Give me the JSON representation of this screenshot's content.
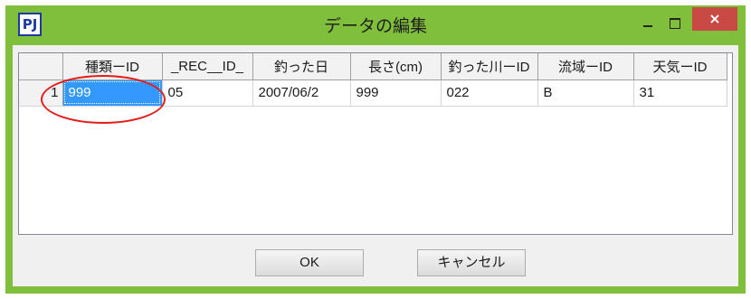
{
  "window": {
    "title": "データの編集",
    "app_icon_text": "PJ",
    "close_glyph": "×",
    "accent_color": "#7fbf3c",
    "close_color": "#c94a44",
    "selection_color": "#3399ff",
    "annotation_color": "#e31c1c"
  },
  "grid": {
    "columns": [
      "種類ーID",
      "_REC__ID_",
      "釣った日",
      "長さ(cm)",
      "釣った川ーID",
      "流域ーID",
      "天気ーID"
    ],
    "rows": [
      {
        "row_number": "1",
        "cells": [
          "999",
          "05",
          "2007/06/2",
          "999",
          "022",
          "B",
          "31"
        ]
      }
    ]
  },
  "buttons": {
    "ok_label": "OK",
    "cancel_label": "キャンセル"
  }
}
